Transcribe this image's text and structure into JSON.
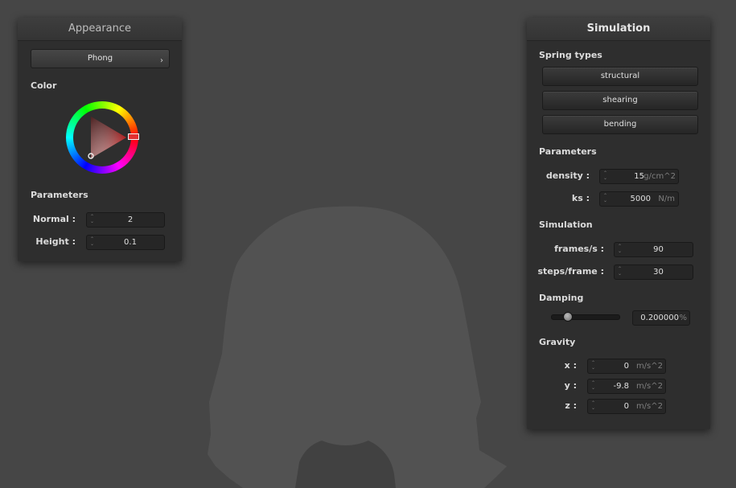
{
  "appearance": {
    "title": "Appearance",
    "shader_selected": "Phong",
    "shader_chevron": "›",
    "color_label": "Color",
    "parameters_label": "Parameters",
    "normal_label": "Normal :",
    "normal_value": "2",
    "height_label": "Height :",
    "height_value": "0.1",
    "selected_color": "#d22a2a"
  },
  "simulation": {
    "title": "Simulation",
    "spring_types_label": "Spring types",
    "spring_buttons": [
      "structural",
      "shearing",
      "bending"
    ],
    "parameters_label": "Parameters",
    "density_label": "density :",
    "density_value": "15",
    "density_unit": "g/cm^2",
    "ks_label": "ks :",
    "ks_value": "5000",
    "ks_unit": "N/m",
    "simulation_label": "Simulation",
    "fps_label": "frames/s :",
    "fps_value": "90",
    "steps_label": "steps/frame :",
    "steps_value": "30",
    "damping_label": "Damping",
    "damping_value": "0.200000",
    "damping_unit": "%",
    "damping_slider_fraction": 0.2,
    "gravity_label": "Gravity",
    "gx_label": "x :",
    "gx_value": "0",
    "gy_label": "y :",
    "gy_value": "-9.8",
    "gz_label": "z :",
    "gz_value": "0",
    "gravity_unit": "m/s^2"
  },
  "spin_glyph_up": "⌃",
  "spin_glyph_down": "⌄"
}
